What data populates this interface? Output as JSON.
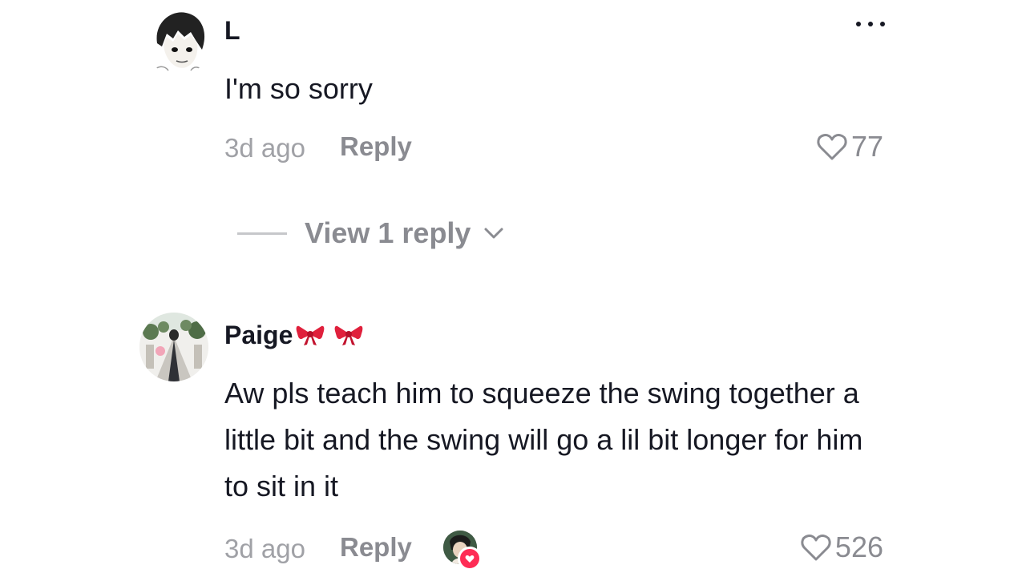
{
  "comments": [
    {
      "username": "L",
      "text": "I'm so sorry",
      "time": "3d ago",
      "reply_label": "Reply",
      "likes": "77",
      "view_replies": "View 1 reply"
    },
    {
      "username": "Paige",
      "text": "Aw pls teach him to squeeze the swing together a little bit and the swing will go a lil bit longer for him to sit in it",
      "time": "3d ago",
      "reply_label": "Reply",
      "likes": "526"
    }
  ],
  "icons": {
    "more": "more-options-icon",
    "like": "heart-outline-icon",
    "chevron": "chevron-down-icon",
    "ribbon": "ribbon-emoji-icon",
    "creator_like": "creator-liked-icon"
  },
  "colors": {
    "text": "#161823",
    "muted": "#8a8b91",
    "accent": "#fe2c55"
  }
}
